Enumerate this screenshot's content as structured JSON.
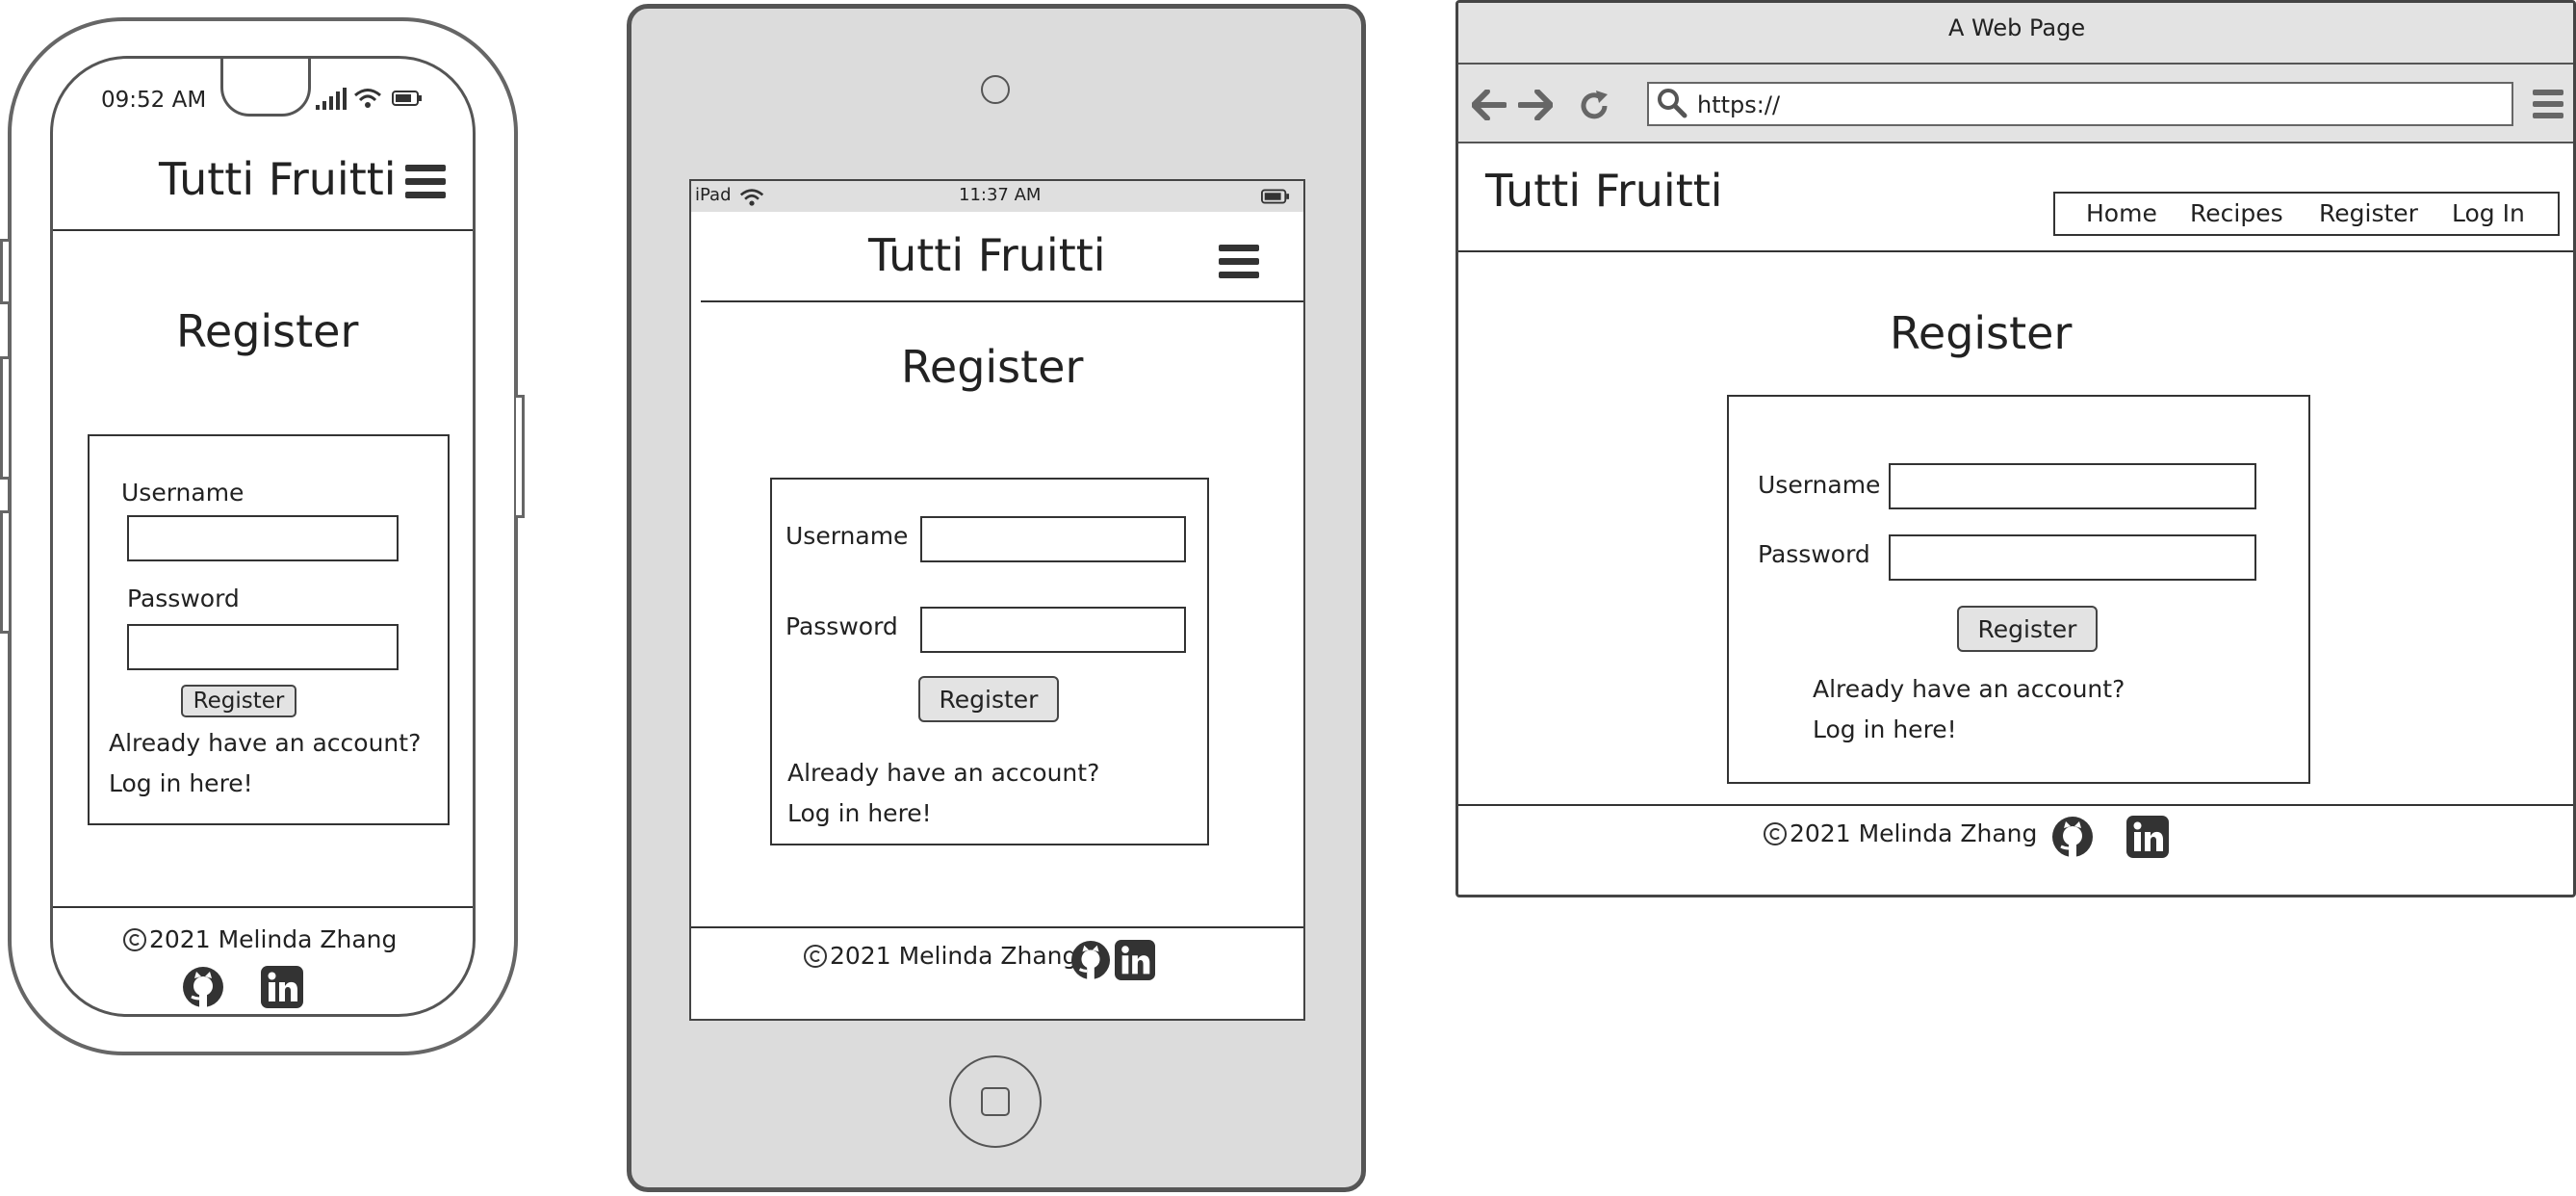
{
  "phone": {
    "status_time": "09:52 AM",
    "brand": "Tutti Fruitti",
    "heading": "Register",
    "username_label": "Username",
    "password_label": "Password",
    "register_label": "Register",
    "already_text": "Already have an account?",
    "login_text": "Log in here!",
    "copyright": "2021 Melinda Zhang"
  },
  "tablet": {
    "status_device": "iPad",
    "status_time": "11:37 AM",
    "brand": "Tutti Fruitti",
    "heading": "Register",
    "username_label": "Username",
    "password_label": "Password",
    "register_label": "Register",
    "already_text": "Already have an account?",
    "login_text": "Log in here!",
    "copyright": "2021 Melinda Zhang"
  },
  "browser": {
    "window_title": "A Web Page",
    "url": "https://",
    "brand": "Tutti Fruitti",
    "nav": [
      "Home",
      "Recipes",
      "Register",
      "Log In"
    ],
    "heading": "Register",
    "username_label": "Username",
    "password_label": "Password",
    "register_label": "Register",
    "already_text": "Already have an account?",
    "login_text": "Log in here!",
    "copyright": "2021 Melinda Zhang"
  },
  "icons": {
    "menu": "hamburger-menu-icon",
    "back": "arrow-left-icon",
    "forward": "arrow-right-icon",
    "reload": "reload-icon",
    "search": "search-icon",
    "github": "github-icon",
    "linkedin": "linkedin-icon",
    "copyright": "copyright-icon",
    "wifi": "wifi-icon",
    "signal": "signal-icon",
    "battery": "battery-icon"
  },
  "colors": {
    "frame_stroke": "#555555",
    "device_gray": "#dcdcdc",
    "button_fill": "#e3e3e3",
    "icon_dark": "#333333"
  }
}
